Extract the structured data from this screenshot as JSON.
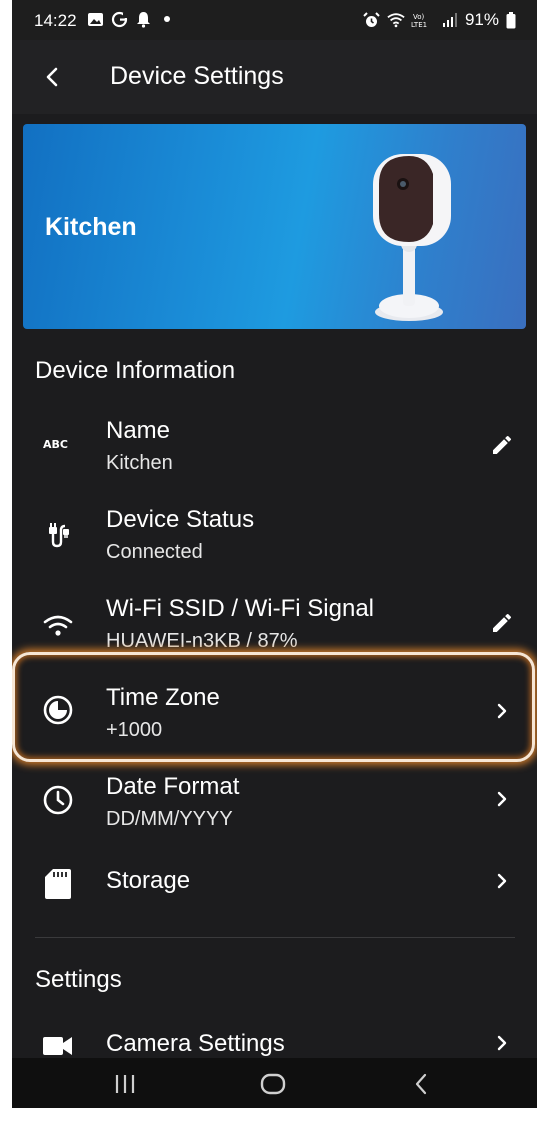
{
  "status_bar": {
    "time": "14:22",
    "battery": "91%",
    "left_icons": [
      "image-icon",
      "g-icon",
      "bell-icon",
      "dot-icon"
    ],
    "right_icons": [
      "alarm-icon",
      "wifi-icon",
      "volte-icon",
      "signal-icon",
      "battery-icon"
    ]
  },
  "app_bar": {
    "title": "Device Settings",
    "back_icon": "chevron-left-icon"
  },
  "hero": {
    "device_name": "Kitchen"
  },
  "device_information": {
    "title": "Device Information",
    "items": [
      {
        "title": "Name",
        "subtitle": "Kitchen",
        "icon": "abc-icon",
        "action_icon": "edit-icon"
      },
      {
        "title": "Device Status",
        "subtitle": "Connected",
        "icon": "plug-icon",
        "action_icon": ""
      },
      {
        "title": "Wi-Fi SSID / Wi-Fi Signal",
        "subtitle": "HUAWEI-n3KB / 87%",
        "icon": "wifi-icon",
        "action_icon": "edit-icon"
      },
      {
        "title": "Time Zone",
        "subtitle": "+1000",
        "icon": "timezone-icon",
        "action_icon": "chevron-right-icon"
      },
      {
        "title": "Date Format",
        "subtitle": "DD/MM/YYYY",
        "icon": "clock-icon",
        "action_icon": "chevron-right-icon"
      },
      {
        "title": "Storage",
        "subtitle": "",
        "icon": "sd-card-icon",
        "action_icon": "chevron-right-icon"
      }
    ]
  },
  "settings": {
    "title": "Settings",
    "items": [
      {
        "title": "Camera Settings",
        "icon": "video-camera-icon",
        "action_icon": "chevron-right-icon"
      }
    ]
  },
  "nav_bar": {
    "buttons": [
      "recents-icon",
      "home-icon",
      "back-icon"
    ]
  },
  "colors": {
    "background": "#1c1c1e",
    "highlight": "#c9782a",
    "hero_blue": "#1e9be0"
  }
}
